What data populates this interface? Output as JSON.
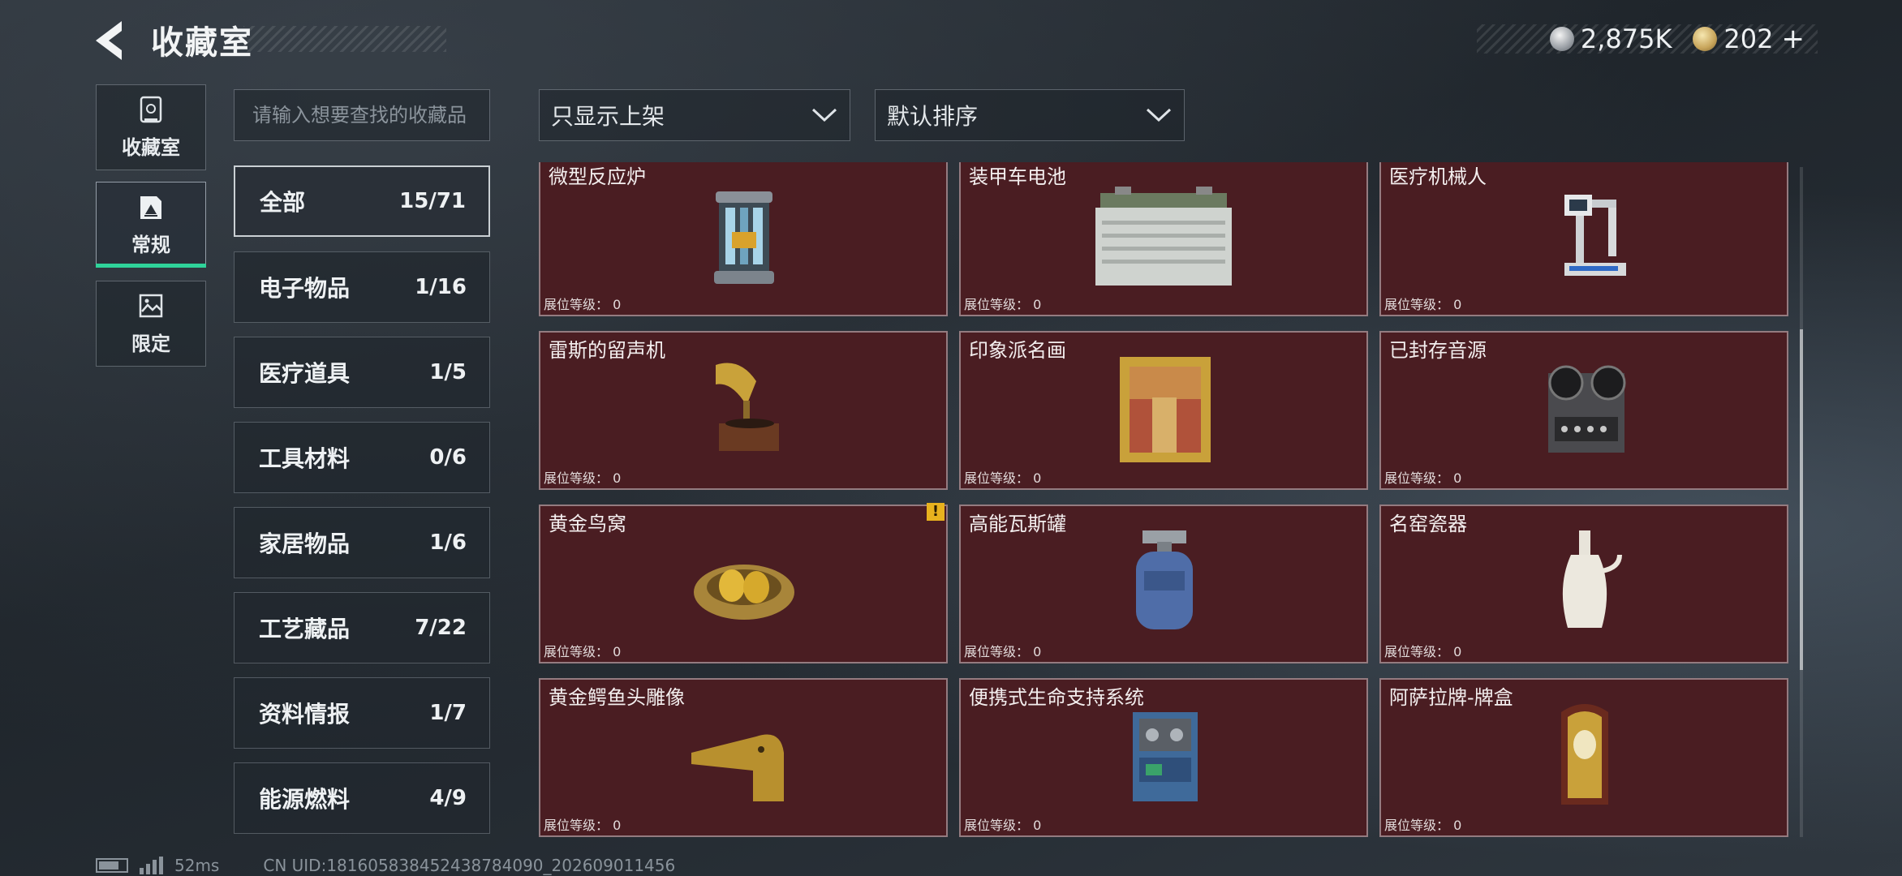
{
  "header": {
    "title": "收藏室",
    "currency_silver": "2,875K",
    "currency_gold": "202",
    "plus": "+"
  },
  "nav": [
    {
      "label": "收藏室",
      "icon": "vault-icon"
    },
    {
      "label": "常规",
      "icon": "frame-icon",
      "active": true
    },
    {
      "label": "限定",
      "icon": "picture-icon"
    }
  ],
  "search": {
    "placeholder": "请输入想要查找的收藏品",
    "value": ""
  },
  "filters": {
    "shelf_filter": "只显示上架",
    "sort": "默认排序"
  },
  "categories": [
    {
      "name": "全部",
      "count": "15/71",
      "active": true
    },
    {
      "name": "电子物品",
      "count": "1/16"
    },
    {
      "name": "医疗道具",
      "count": "1/5"
    },
    {
      "name": "工具材料",
      "count": "0/6"
    },
    {
      "name": "家居物品",
      "count": "1/6"
    },
    {
      "name": "工艺藏品",
      "count": "7/22"
    },
    {
      "name": "资料情报",
      "count": "1/7"
    },
    {
      "name": "能源燃料",
      "count": "4/9"
    }
  ],
  "level_label": "展位等级：",
  "items": [
    {
      "name": "微型反应炉",
      "level": "0"
    },
    {
      "name": "装甲车电池",
      "level": "0"
    },
    {
      "name": "医疗机械人",
      "level": "0"
    },
    {
      "name": "雷斯的留声机",
      "level": "0"
    },
    {
      "name": "印象派名画",
      "level": "0"
    },
    {
      "name": "已封存音源",
      "level": "0"
    },
    {
      "name": "黄金鸟窝",
      "level": "0",
      "warning": "!"
    },
    {
      "name": "高能瓦斯罐",
      "level": "0"
    },
    {
      "name": "名窑瓷器",
      "level": "0"
    },
    {
      "name": "黄金鳄鱼头雕像",
      "level": "0"
    },
    {
      "name": "便携式生命支持系统",
      "level": "0"
    },
    {
      "name": "阿萨拉牌-牌盒",
      "level": "0"
    }
  ],
  "footer": {
    "ping": "52ms",
    "uid": "CN UID:1816058384524387840​90_202609011456"
  },
  "colors": {
    "accent": "#2fd39a",
    "card_bg": "#4a1d22",
    "warning": "#e8b21e"
  }
}
